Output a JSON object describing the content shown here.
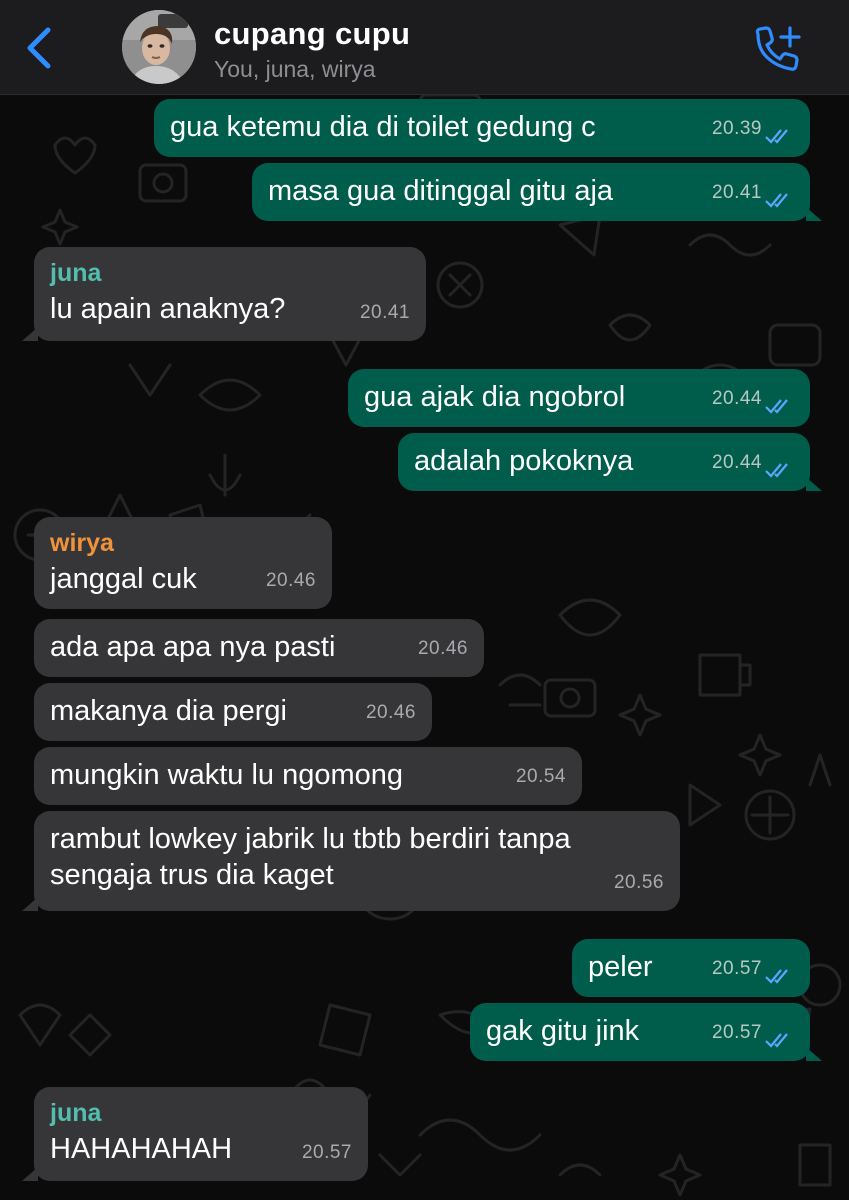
{
  "header": {
    "title": "cupang cupu",
    "subtitle": "You, juna, wirya",
    "back_icon": "chevron-left-icon",
    "call_icon": "add-call-icon",
    "accent": "#2f8cff"
  },
  "colors": {
    "outgoing_bubble": "#005c4b",
    "incoming_bubble": "#363638",
    "juna": "#53bdb0",
    "wirya": "#f0933a",
    "read_ticks": "#5aa7ff"
  },
  "messages": [
    {
      "dir": "out",
      "text": "gua ketemu dia di toilet gedung c",
      "time": "20.39",
      "status": "read"
    },
    {
      "dir": "out",
      "text": "masa gua ditinggal gitu aja",
      "time": "20.41",
      "status": "read"
    },
    {
      "dir": "in",
      "sender": "juna",
      "text": "lu apain anaknya?",
      "time": "20.41"
    },
    {
      "dir": "out",
      "text": "gua ajak dia ngobrol",
      "time": "20.44",
      "status": "read"
    },
    {
      "dir": "out",
      "text": "adalah pokoknya",
      "time": "20.44",
      "status": "read"
    },
    {
      "dir": "in",
      "sender": "wirya",
      "text": "janggal cuk",
      "time": "20.46"
    },
    {
      "dir": "in",
      "text": "ada apa apa nya pasti",
      "time": "20.46"
    },
    {
      "dir": "in",
      "text": "makanya dia pergi",
      "time": "20.46"
    },
    {
      "dir": "in",
      "text": "mungkin waktu lu ngomong",
      "time": "20.54"
    },
    {
      "dir": "in",
      "text": "rambut lowkey jabrik lu tbtb berdiri tanpa sengaja trus dia kaget",
      "time": "20.56"
    },
    {
      "dir": "out",
      "text": "peler",
      "time": "20.57",
      "status": "read"
    },
    {
      "dir": "out",
      "text": "gak gitu jink",
      "time": "20.57",
      "status": "read"
    },
    {
      "dir": "in",
      "sender": "juna",
      "text": "HAHAHAHAH",
      "time": "20.57"
    }
  ]
}
